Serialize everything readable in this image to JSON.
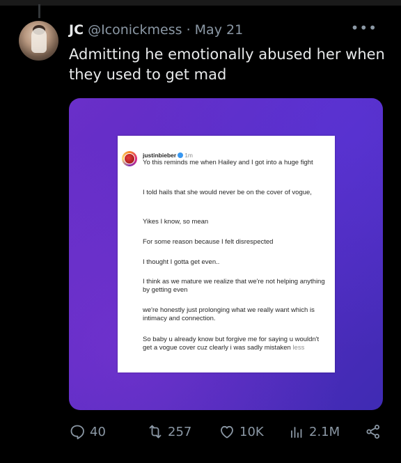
{
  "tweet": {
    "name": "JC",
    "handle": "@Iconickmess",
    "separator": "·",
    "date": "May 21",
    "more": "•••",
    "text": "Admitting he emotionally abused her when they used to get mad"
  },
  "instagram_post": {
    "username": "justinbieber",
    "time": "1m",
    "paragraphs": [
      "Yo this reminds  me when Hailey and I got into a huge fight",
      "I told hails that she would never be on the cover of vogue,",
      "Yikes I know, so mean",
      "For some reason because I felt disrespected",
      "I thought I gotta get even..",
      "I think as we mature we realize that we're not helping anything by getting even",
      "we're honestly just prolonging what we really want which is intimacy and connection.",
      "So baby u already know but forgive me for saying u wouldn't get a vogue cover cuz clearly i was sadly mistaken"
    ],
    "less_label": "less"
  },
  "actions": {
    "replies": "40",
    "reposts": "257",
    "likes": "10K",
    "views": "2.1M"
  },
  "colors": {
    "background": "#000000",
    "text": "#e7e9ea",
    "secondary": "#8b98a5",
    "media_purple": "#5a2cc4"
  }
}
